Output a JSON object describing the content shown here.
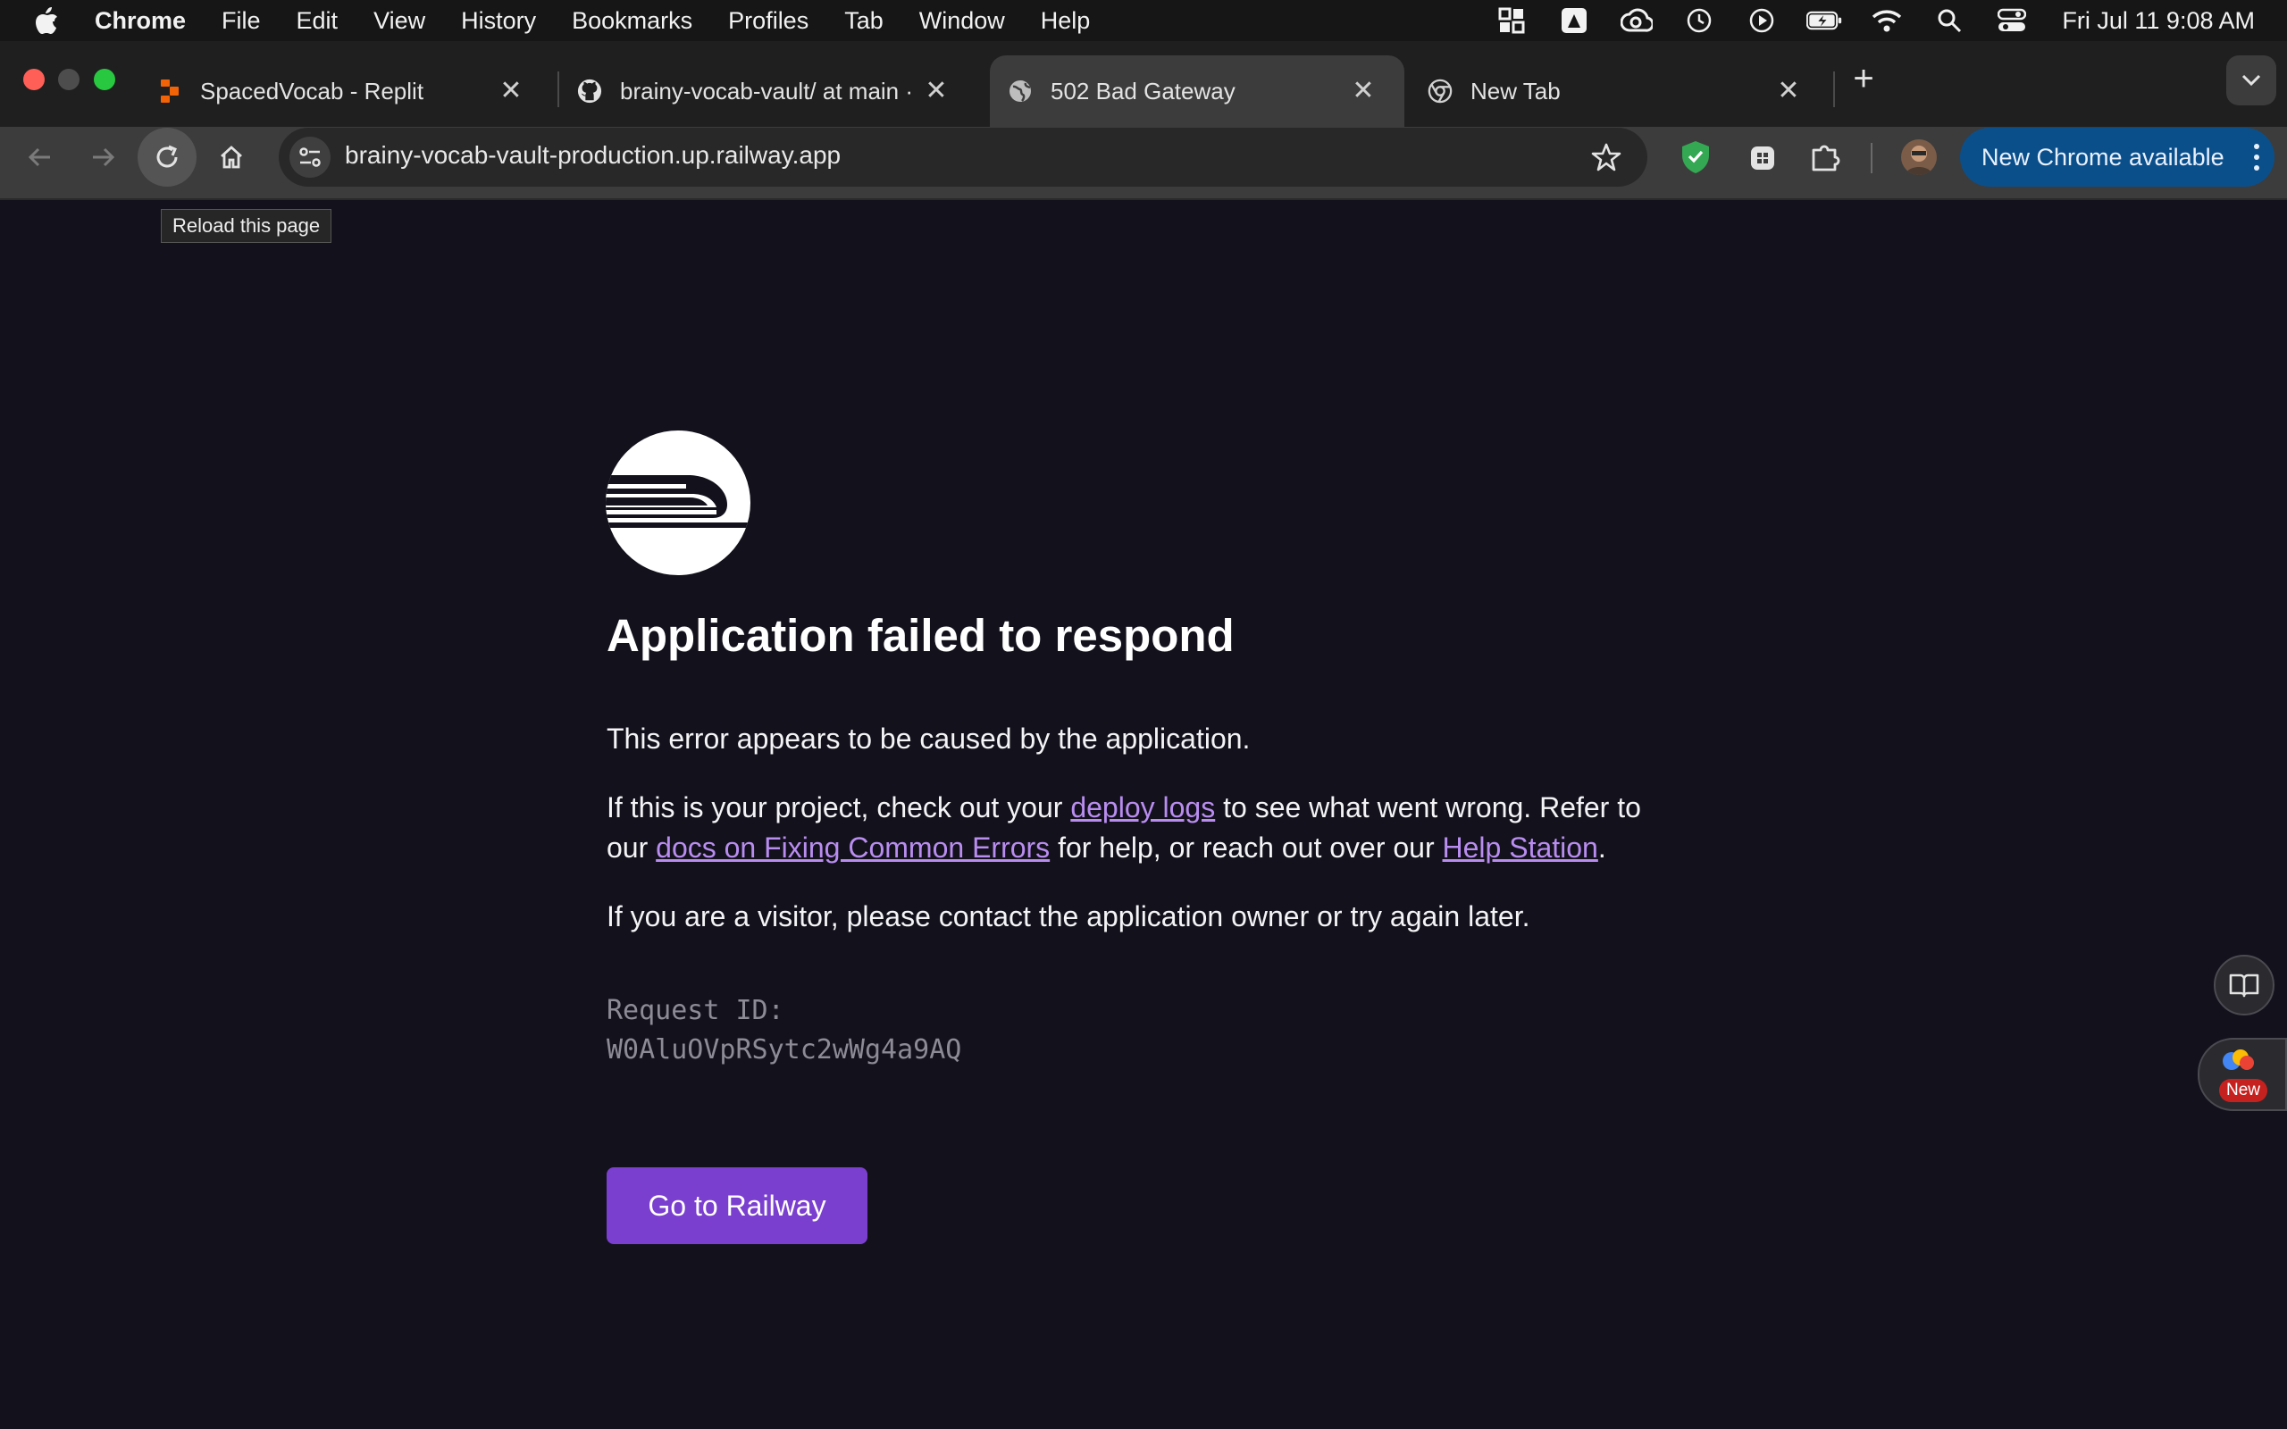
{
  "menubar": {
    "app_name": "Chrome",
    "items": [
      "File",
      "Edit",
      "View",
      "History",
      "Bookmarks",
      "Profiles",
      "Tab",
      "Window",
      "Help"
    ],
    "clock": "Fri Jul 11  9:08 AM"
  },
  "tabs": [
    {
      "title": "SpacedVocab - Replit",
      "icon": "replit-icon"
    },
    {
      "title": "brainy-vocab-vault/ at main ·",
      "icon": "github-icon"
    },
    {
      "title": "502 Bad Gateway",
      "icon": "globe-icon",
      "active": true
    },
    {
      "title": "New Tab",
      "icon": "chrome-icon"
    }
  ],
  "toolbar": {
    "url": "brainy-vocab-vault-production.up.railway.app",
    "new_chrome_label": "New Chrome available",
    "reload_tooltip": "Reload this page"
  },
  "page": {
    "heading": "Application failed to respond",
    "p1": "This error appears to be caused by the application.",
    "p2_a": "If this is your project, check out your ",
    "p2_link1": "deploy logs",
    "p2_b": " to see what went wrong. Refer to",
    "p2_c": "our ",
    "p2_link2": "docs on Fixing Common Errors",
    "p2_d": " for help, or reach out over our ",
    "p2_link3": "Help Station",
    "p2_e": ".",
    "p3": "If you are a visitor, please contact the application owner or try again later.",
    "request_id_label": "Request ID:",
    "request_id": "W0AluOVpRSytc2wWg4a9AQ",
    "button": "Go to Railway"
  },
  "side": {
    "new_badge": "New"
  },
  "colors": {
    "page_bg": "#13111c",
    "link": "#b98df0",
    "button": "#7b3fcf",
    "new_chrome_pill": "#0b4f8a"
  }
}
